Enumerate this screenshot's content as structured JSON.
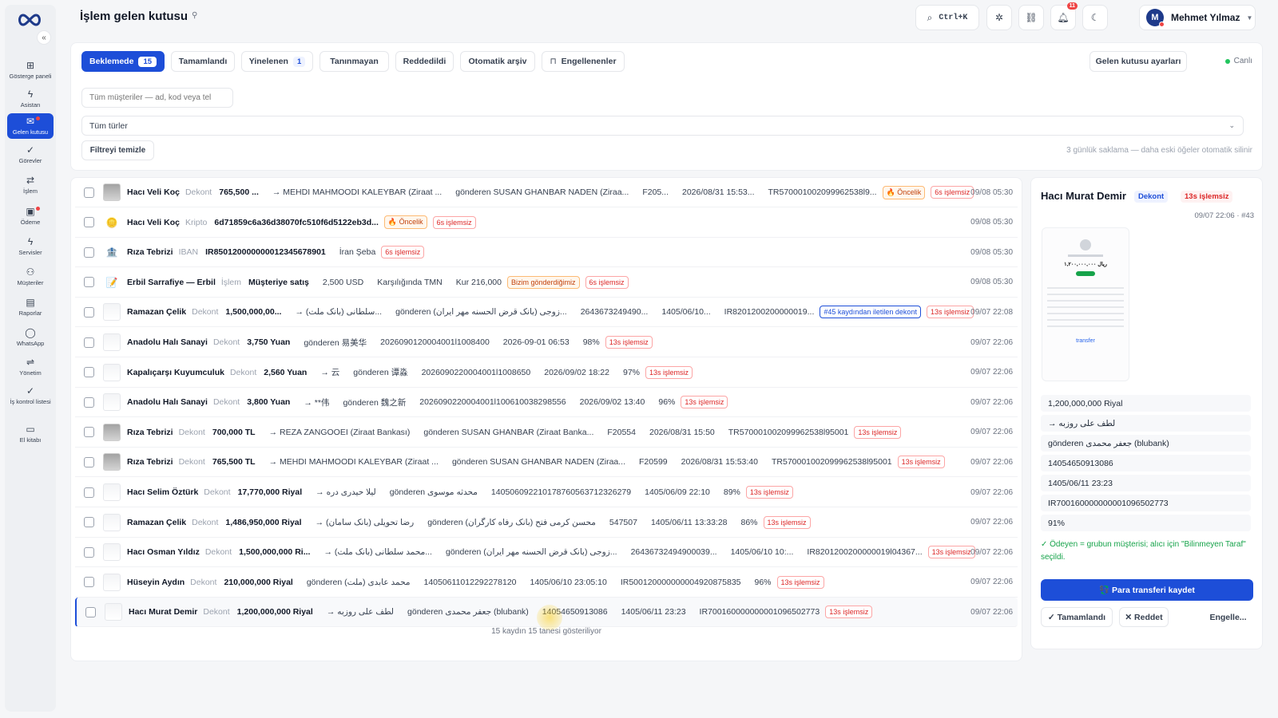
{
  "header": {
    "title": "İşlem gelen kutusu",
    "search_shortcut": "Ctrl+K",
    "notification_count": "11",
    "user_initial": "M",
    "user_name": "Mehmet Yılmaz"
  },
  "sidebar": {
    "items": [
      {
        "label": "Gösterge paneli",
        "icon": "dashboard-icon",
        "glyph": "⊞"
      },
      {
        "label": "Asistan",
        "icon": "bolt-icon",
        "glyph": "ϟ"
      },
      {
        "label": "Gelen kutusu",
        "icon": "inbox-icon",
        "glyph": "✉"
      },
      {
        "label": "Görevler",
        "icon": "check-icon",
        "glyph": "✓"
      },
      {
        "label": "İşlem",
        "icon": "transfer-icon",
        "glyph": "⇄"
      },
      {
        "label": "Ödeme",
        "icon": "payment-icon",
        "glyph": "▣"
      },
      {
        "label": "Servisler",
        "icon": "bolt-icon",
        "glyph": "ϟ"
      },
      {
        "label": "Müşteriler",
        "icon": "users-icon",
        "glyph": "⚇"
      },
      {
        "label": "Raporlar",
        "icon": "report-icon",
        "glyph": "▤"
      },
      {
        "label": "WhatsApp",
        "icon": "chat-icon",
        "glyph": "◯"
      },
      {
        "label": "Yönetim",
        "icon": "sliders-icon",
        "glyph": "⇌"
      },
      {
        "label": "İş kontrol listesi",
        "icon": "checklist-icon",
        "glyph": "✓"
      },
      {
        "label": "El kitabı",
        "icon": "book-icon",
        "glyph": "▭"
      }
    ]
  },
  "tabs": [
    {
      "label": "Beklemede",
      "count": "15"
    },
    {
      "label": "Tamamlandı"
    },
    {
      "label": "Yinelenen",
      "count": "1"
    },
    {
      "label": "Tanınmayan"
    },
    {
      "label": "Reddedildi"
    },
    {
      "label": "Otomatik arşiv"
    },
    {
      "label": "Engellenenler"
    }
  ],
  "filters": {
    "settings_label": "Gelen kutusu ayarları",
    "live_label": "Canlı",
    "search_placeholder": "Tüm müşteriler — ad, kod veya tel",
    "type_select": "Tüm türler",
    "clear_label": "Filtreyi temizle",
    "retention_note": "3 günlük saklama — daha eski öğeler otomatik silinir"
  },
  "rows": [
    {
      "customer": "Hacı Veli Koç",
      "type": "Dekont",
      "amount": "765,500 ...",
      "fields": [
        "→ MEHDI MAHMOODI KALEYBAR (Ziraat ...",
        "gönderen SUSAN GHANBAR NADEN (Ziraa...",
        "F205...",
        "2026/08/31 15:53...",
        "TR570001002099962538l9..."
      ],
      "tags": [
        {
          "t": "🔥 Öncelik",
          "k": "org"
        },
        {
          "t": "6s işlemsiz",
          "k": "red"
        }
      ],
      "time": "09/08 05:30",
      "thumb": "dark"
    },
    {
      "customer": "Hacı Veli Koç",
      "type": "Kripto",
      "amount": "6d71859c6a36d38070fc510f6d5122eb3d...",
      "fields": [],
      "tags": [
        {
          "t": "🔥 Öncelik",
          "k": "org"
        },
        {
          "t": "6s işlemsiz",
          "k": "red"
        }
      ],
      "time": "09/08 05:30",
      "thumb": "coin"
    },
    {
      "customer": "Rıza Tebrizi",
      "type": "IBAN",
      "amount": "IR850120000000012345678901",
      "fields": [
        "İran Şeba"
      ],
      "tags": [
        {
          "t": "6s işlemsiz",
          "k": "red"
        }
      ],
      "time": "09/08 05:30",
      "thumb": "bank"
    },
    {
      "customer": "Erbil Sarrafiye — Erbil",
      "type": "İşlem",
      "amount": "Müşteriye satış",
      "fields": [
        "2,500 USD",
        "Karşılığında TMN",
        "Kur 216,000"
      ],
      "tags": [
        {
          "t": "Bizim gönderdiğimiz",
          "k": "org"
        },
        {
          "t": "6s işlemsiz",
          "k": "red"
        }
      ],
      "time": "09/08 05:30",
      "thumb": "note"
    },
    {
      "customer": "Ramazan Çelik",
      "type": "Dekont",
      "amount": "1,500,000,00...",
      "fields": [
        "→ سلطانی (بانک ملت)...",
        "gönderen (بانک قرض الحسنه مهر ایران) زوجی...",
        "2643673249490...",
        "1405/06/10...",
        "IR8201200200000019..."
      ],
      "tags": [
        {
          "t": "#45 kaydından iletilen dekont",
          "k": "blue"
        },
        {
          "t": "13s işlemsiz",
          "k": "red"
        }
      ],
      "time": "09/07 22:08",
      "thumb": "light"
    },
    {
      "customer": "Anadolu Halı Sanayi",
      "type": "Dekont",
      "amount": "3,750 Yuan",
      "fields": [
        "gönderen 易美华",
        "2026090120004001l1008400",
        "2026-09-01 06:53",
        "98%"
      ],
      "tags": [
        {
          "t": "13s işlemsiz",
          "k": "red"
        }
      ],
      "time": "09/07 22:06",
      "thumb": "light"
    },
    {
      "customer": "Kapalıçarşı Kuyumculuk",
      "type": "Dekont",
      "amount": "2,560 Yuan",
      "fields": [
        "→ 云",
        "gönderen 谭淼",
        "2026090220004001l1008650",
        "2026/09/02 18:22",
        "97%"
      ],
      "tags": [
        {
          "t": "13s işlemsiz",
          "k": "red"
        }
      ],
      "time": "09/07 22:06",
      "thumb": "light"
    },
    {
      "customer": "Anadolu Halı Sanayi",
      "type": "Dekont",
      "amount": "3,800 Yuan",
      "fields": [
        "→ **伟",
        "gönderen 魏之新",
        "2026090220004001l10061003829855​6",
        "2026/09/02 13:40",
        "96%"
      ],
      "tags": [
        {
          "t": "13s işlemsiz",
          "k": "red"
        }
      ],
      "time": "09/07 22:06",
      "thumb": "light"
    },
    {
      "customer": "Rıza Tebrizi",
      "type": "Dekont",
      "amount": "700,000 TL",
      "fields": [
        "→ REZA ZANGOOEI (Ziraat Bankası)",
        "gönderen SUSAN GHANBAR (Ziraat Banka...",
        "F20554",
        "2026/08/31 15:50",
        "TR570001002099962538l95001"
      ],
      "tags": [
        {
          "t": "13s işlemsiz",
          "k": "red"
        }
      ],
      "time": "09/07 22:06",
      "thumb": "dark"
    },
    {
      "customer": "Rıza Tebrizi",
      "type": "Dekont",
      "amount": "765,500 TL",
      "fields": [
        "→ MEHDI MAHMOODI KALEYBAR (Ziraat ...",
        "gönderen SUSAN GHANBAR NADEN (Ziraa...",
        "F20599",
        "2026/08/31 15:53:40",
        "TR570001002099962538l95001"
      ],
      "tags": [
        {
          "t": "13s işlemsiz",
          "k": "red"
        }
      ],
      "time": "09/07 22:06",
      "thumb": "dark"
    },
    {
      "customer": "Hacı Selim Öztürk",
      "type": "Dekont",
      "amount": "17,770,000 Riyal",
      "fields": [
        "→ لیلا حیدری دره",
        "gönderen محدثه موسوی",
        "14050609221017876056371232627​9",
        "1405/06/09 22:10",
        "89%"
      ],
      "tags": [
        {
          "t": "13s işlemsiz",
          "k": "red"
        }
      ],
      "time": "09/07 22:06",
      "thumb": "light"
    },
    {
      "customer": "Ramazan Çelik",
      "type": "Dekont",
      "amount": "1,486,950,000 Riyal",
      "fields": [
        "→ رضا تحویلی (بانک سامان)",
        "gönderen محسن کرمی فتح (بانک رفاه کارگران)",
        "547507",
        "1405/06/11 13:33:28",
        "86%"
      ],
      "tags": [
        {
          "t": "13s işlemsiz",
          "k": "red"
        }
      ],
      "time": "09/07 22:06",
      "thumb": "light"
    },
    {
      "customer": "Hacı Osman Yıldız",
      "type": "Dekont",
      "amount": "1,500,000,000 Ri...",
      "fields": [
        "→ محمد سلطانی (بانک ملت)...",
        "gönderen (بانک قرض الحسنه مهر ایران) زوجی...",
        "2643673249490003​9...",
        "1405/06/10 10:...",
        "IR8201200200000019l04367..."
      ],
      "tags": [
        {
          "t": "13s işlemsiz",
          "k": "red"
        }
      ],
      "time": "09/07 22:06",
      "thumb": "light"
    },
    {
      "customer": "Hüseyin Aydın",
      "type": "Dekont",
      "amount": "210,000,000 Riyal",
      "fields": [
        "gönderen محمد عابدی (ملت)",
        "140506110122922781​20",
        "1405/06/10 23:05:10",
        "IR500120000000004920875835",
        "96%"
      ],
      "tags": [
        {
          "t": "13s işlemsiz",
          "k": "red"
        }
      ],
      "time": "09/07 22:06",
      "thumb": "light"
    },
    {
      "customer": "Hacı Murat Demir",
      "type": "Dekont",
      "amount": "1,200,000,000 Riyal",
      "fields": [
        "→ لطف علی روزبه",
        "gönderen جعفر محمدی (blubank)",
        "14054650913086",
        "1405/06/11 23:23",
        "IR700160000000001096502773"
      ],
      "tags": [
        {
          "t": "13s işlemsiz",
          "k": "red"
        }
      ],
      "time": "09/07 22:06",
      "thumb": "light"
    }
  ],
  "list_footer": "15 kaydın 15 tanesi gösteriliyor",
  "detail": {
    "name": "Hacı Murat Demir",
    "type": "Dekont",
    "status": "13s işlemsiz",
    "meta": "09/07 22:06 · #43",
    "receipt_amount": "۱,۲۰۰,۰۰۰,۰۰۰ ریال",
    "receipt_brand": "transfer",
    "fields": [
      "1,200,000,000 Riyal",
      "→ لطف علی روزبه",
      "gönderen جعفر محمدی (blubank)",
      "14054650913086",
      "1405/06/11 23:23",
      "IR700160000000001096502773",
      "91%"
    ],
    "note": "✓ Ödeyen = grubun müşterisi; alıcı için \"Bilinmeyen Taraf\" seçildi.",
    "save_label": "💱 Para transferi kaydet",
    "complete_label": "✓ Tamamlandı",
    "reject_label": "✕ Reddet",
    "block_label": "Engelle..."
  }
}
